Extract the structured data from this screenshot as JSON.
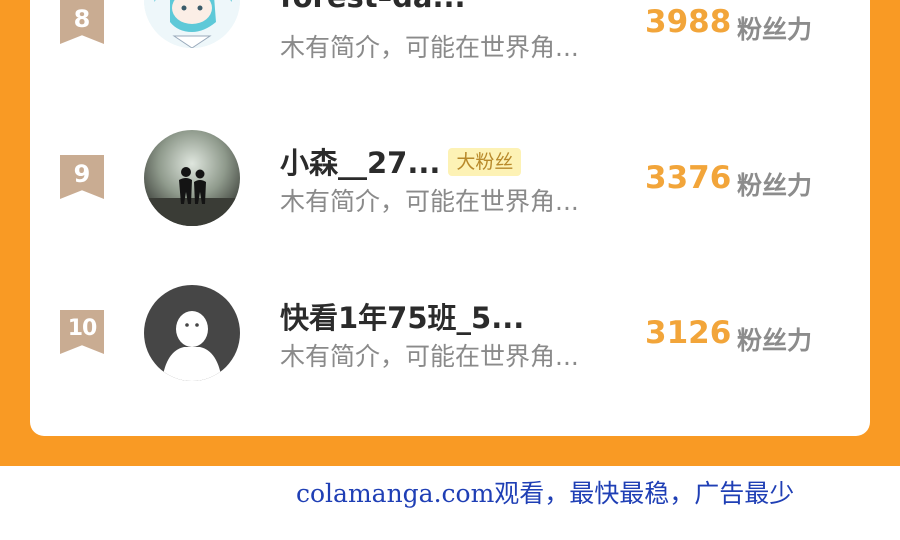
{
  "rows": [
    {
      "rank": "8",
      "name": "forest–da...",
      "badge": "",
      "intro": "木有简介，可能在世界角...",
      "fans": "3988",
      "fans_label": "粉丝力",
      "avatar": "anime-boy-avatar"
    },
    {
      "rank": "9",
      "name": "小森__27...",
      "badge": "大粉丝",
      "intro": "木有简介，可能在世界角...",
      "fans": "3376",
      "fans_label": "粉丝力",
      "avatar": "couple-silhouette-avatar"
    },
    {
      "rank": "10",
      "name": "快看1年75班_5...",
      "badge": "",
      "intro": "木有简介，可能在世界角...",
      "fans": "3126",
      "fans_label": "粉丝力",
      "avatar": "default-user-avatar"
    }
  ],
  "watermark": "colamanga.com观看，最快最稳，广告最少",
  "colors": {
    "frame": "#f99a24",
    "fans": "#f2a53a",
    "badge_bg": "#fdf2b5",
    "rank_flag": "#c9ac92"
  }
}
